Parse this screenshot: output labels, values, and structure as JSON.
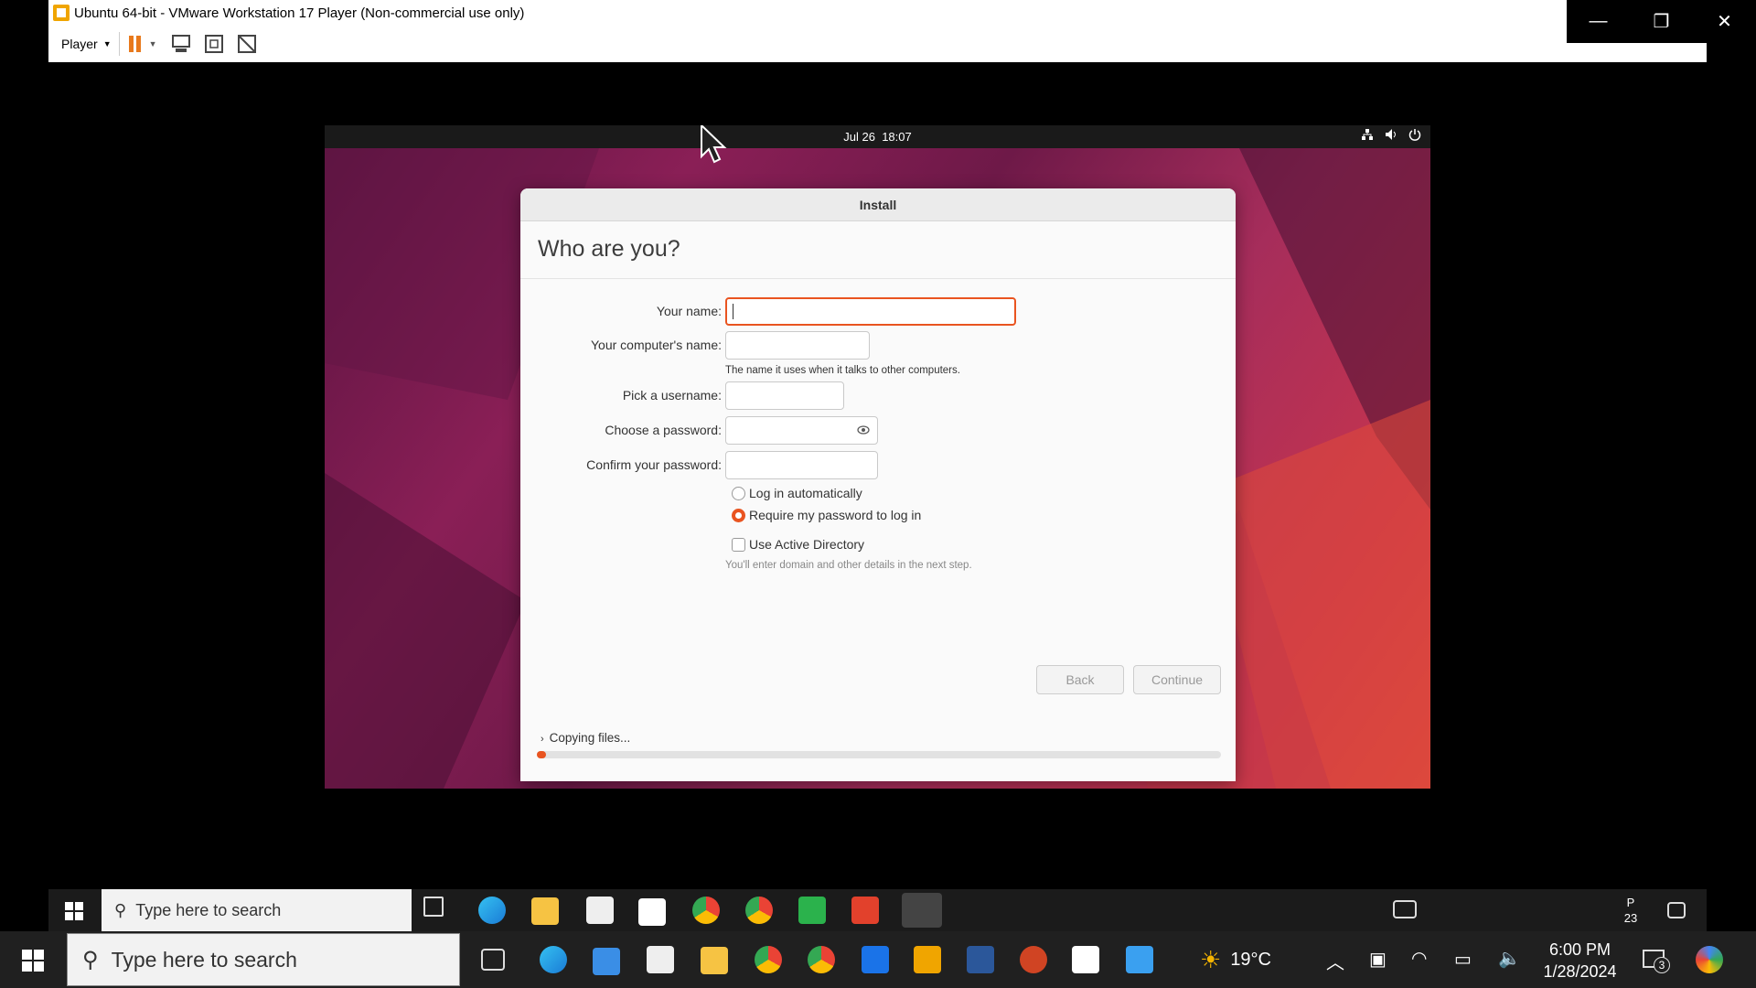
{
  "vm_window": {
    "title": "Ubuntu 64-bit - VMware Workstation 17 Player (Non-commercial use only)",
    "player_menu_label": "Player"
  },
  "guest_topbar": {
    "date": "Jul 26",
    "time": "18:07"
  },
  "installer": {
    "window_title": "Install",
    "heading": "Who are you?",
    "fields": {
      "your_name": {
        "label": "Your name:",
        "value": ""
      },
      "computer_name": {
        "label": "Your computer's name:",
        "value": "",
        "hint": "The name it uses when it talks to other computers."
      },
      "username": {
        "label": "Pick a username:",
        "value": ""
      },
      "password": {
        "label": "Choose a password:",
        "value": ""
      },
      "confirm_password": {
        "label": "Confirm your password:",
        "value": ""
      }
    },
    "login_options": {
      "auto_login": "Log in automatically",
      "require_password": "Require my password to log in",
      "selected": "require_password"
    },
    "active_directory": {
      "label": "Use Active Directory",
      "checked": false,
      "hint": "You'll enter domain and other details in the next step."
    },
    "buttons": {
      "back": "Back",
      "continue": "Continue"
    },
    "progress": {
      "label": "Copying files...",
      "fraction": 0.01
    },
    "accent_color": "#e95420"
  },
  "taskbar_inner": {
    "search_placeholder": "Type here to search",
    "clock_line1": "P",
    "clock_line2": "23"
  },
  "taskbar_outer": {
    "search_placeholder": "Type here to search",
    "weather": "19°C",
    "time": "6:00 PM",
    "date": "1/28/2024",
    "notification_count": "3"
  }
}
